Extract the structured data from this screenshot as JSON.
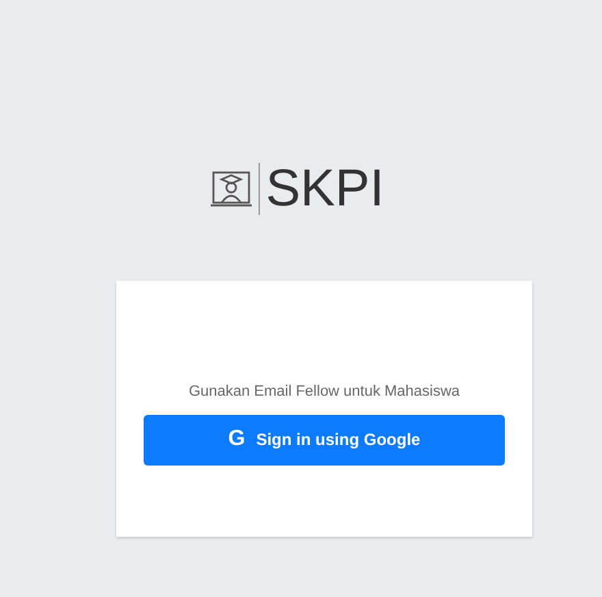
{
  "logo": {
    "text": "SKPI"
  },
  "card": {
    "hint": "Gunakan Email Fellow untuk Mahasiswa",
    "button": {
      "icon": "G",
      "label": "Sign in using Google"
    }
  }
}
